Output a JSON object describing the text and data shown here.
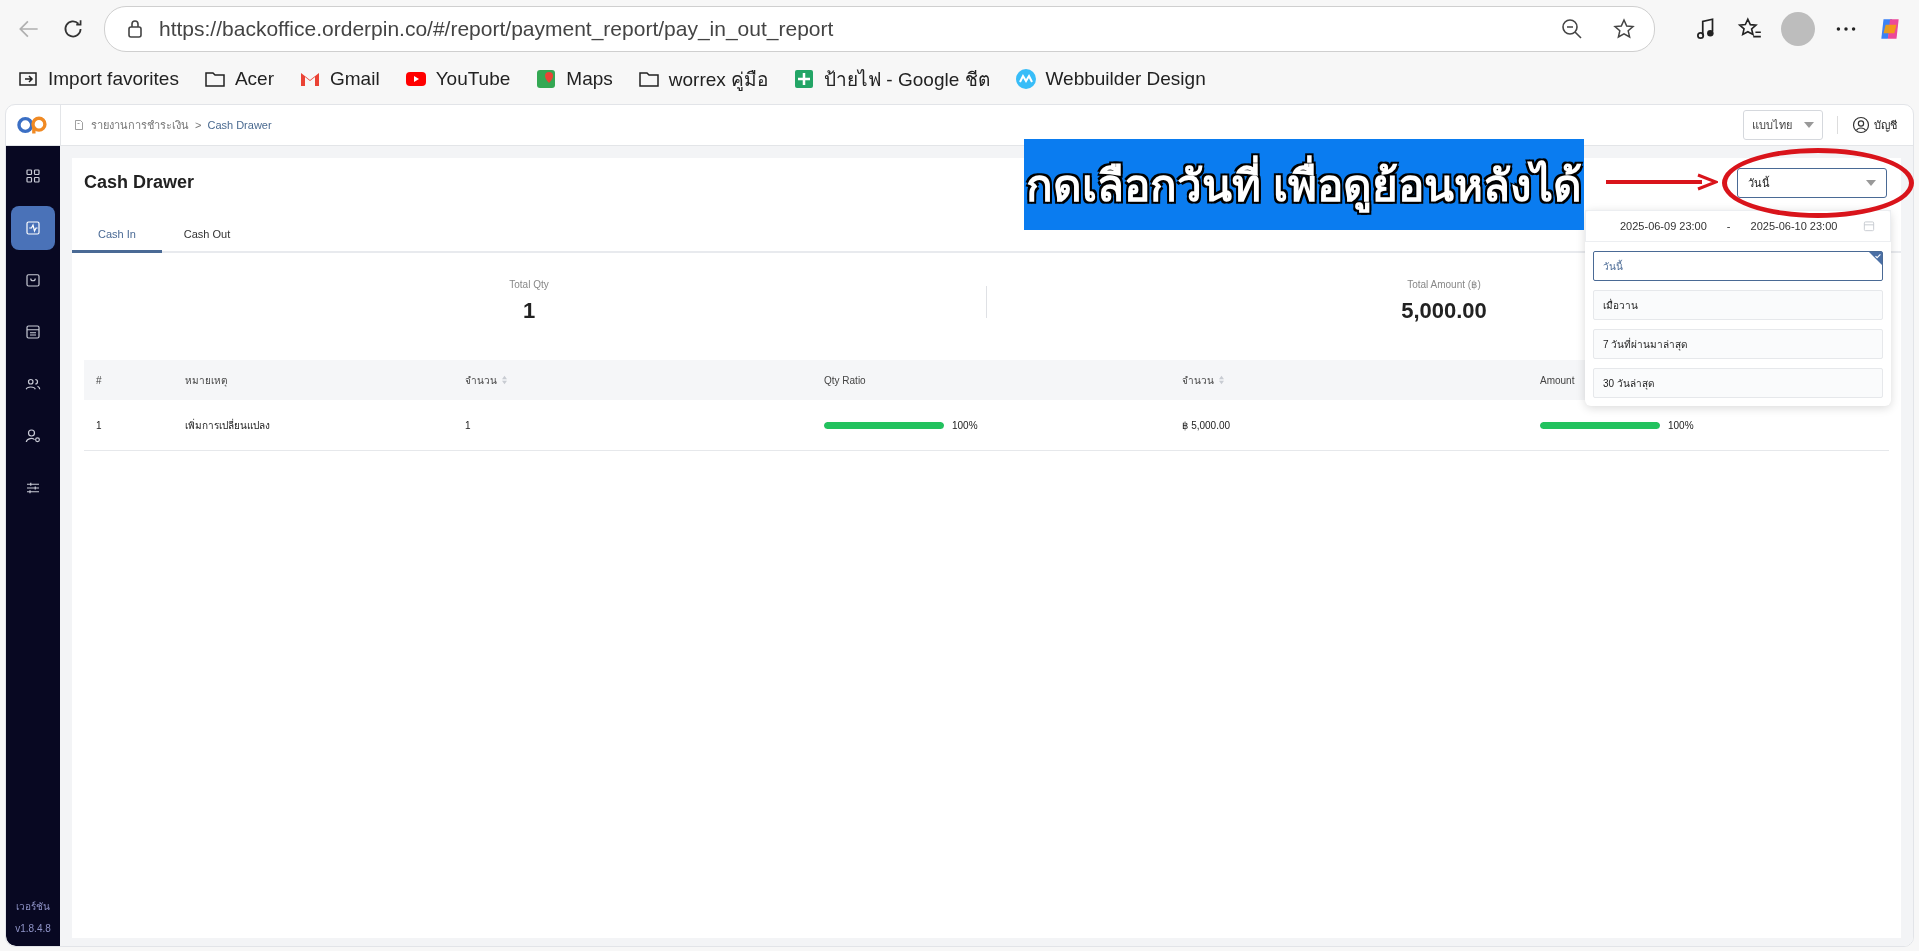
{
  "browser": {
    "url": "https://backoffice.orderpin.co/#/report/payment_report/pay_in_out_report",
    "bookmarks": [
      {
        "label": "Import favorites",
        "kind": "import"
      },
      {
        "label": "Acer",
        "kind": "folder"
      },
      {
        "label": "Gmail",
        "kind": "gmail"
      },
      {
        "label": "YouTube",
        "kind": "youtube"
      },
      {
        "label": "Maps",
        "kind": "maps"
      },
      {
        "label": "worrex คู่มือ",
        "kind": "folder"
      },
      {
        "label": "ป้ายไฟ - Google ชีต",
        "kind": "sheets"
      },
      {
        "label": "Webbuilder Design",
        "kind": "webbuilder"
      }
    ]
  },
  "header": {
    "breadcrumb": [
      "รายงานการชำระเงิน",
      "Cash Drawer"
    ],
    "breadcrumb_separator": ">",
    "language": "แบบไทย",
    "account": "บัญชี"
  },
  "sidebar": {
    "items": [
      {
        "kind": "grid",
        "selected": false
      },
      {
        "kind": "activity",
        "selected": true
      },
      {
        "kind": "bag",
        "selected": false
      },
      {
        "kind": "register",
        "selected": false
      },
      {
        "kind": "users",
        "selected": false
      },
      {
        "kind": "user-settings",
        "selected": false
      },
      {
        "kind": "sliders",
        "selected": false
      }
    ],
    "version_label": "เวอร์ชัน",
    "version": "v1.8.4.8"
  },
  "page": {
    "title": "Cash Drawer",
    "tabs": [
      {
        "label": "Cash In",
        "selected": true
      },
      {
        "label": "Cash Out",
        "selected": false
      }
    ],
    "date_filter": {
      "value": "วันนี้"
    },
    "date_range": {
      "start": "2025-06-09 23:00",
      "separator": "-",
      "end": "2025-06-10 23:00"
    },
    "presets": [
      {
        "label": "วันนี้",
        "selected": true
      },
      {
        "label": "เมื่อวาน",
        "selected": false
      },
      {
        "label": "7 วันที่ผ่านมาล่าสุด",
        "selected": false
      },
      {
        "label": "30 วันล่าสุด",
        "selected": false
      }
    ],
    "summary": [
      {
        "label": "Total Qty",
        "value": "1"
      },
      {
        "label": "Total Amount (฿)",
        "value": "5,000.00"
      }
    ],
    "table": {
      "columns": [
        {
          "label": "#",
          "sortable": false
        },
        {
          "label": "หมายเหตุ",
          "sortable": false
        },
        {
          "label": "จำนวน",
          "sortable": true
        },
        {
          "label": "Qty Ratio",
          "sortable": false
        },
        {
          "label": "จำนวน",
          "sortable": true
        },
        {
          "label": "Amount",
          "sortable": false
        }
      ],
      "rows": [
        {
          "index": "1",
          "note": "เพิ่มการเปลี่ยนแปลง",
          "qty": "1",
          "qty_ratio": {
            "level": 1,
            "text": "100%"
          },
          "amount": "฿ 5,000.00",
          "amount_ratio": {
            "level": 1,
            "text": "100%"
          }
        }
      ]
    }
  },
  "annotation": {
    "text": "กดเลือกวันที่ เพื่อดูย้อนหลังได้"
  }
}
